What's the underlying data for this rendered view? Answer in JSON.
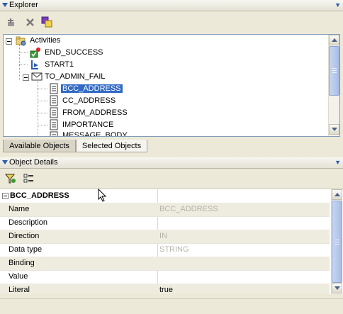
{
  "explorer": {
    "title": "Explorer",
    "toolbar": [
      "add-node-icon",
      "delete-icon",
      "copy-icon"
    ],
    "tree": {
      "root": "Activities",
      "items": [
        "END_SUCCESS",
        "START1",
        "TO_ADMIN_FAIL"
      ],
      "children": [
        "BCC_ADDRESS",
        "CC_ADDRESS",
        "FROM_ADDRESS",
        "IMPORTANCE",
        "MESSAGE_BODY"
      ]
    },
    "tabs": [
      "Available Objects",
      "Selected Objects"
    ]
  },
  "details": {
    "title": "Object Details",
    "toolbar": [
      "filter-icon",
      "categorize-icon"
    ],
    "header": "BCC_ADDRESS",
    "rows": [
      {
        "name": "Name",
        "value": "BCC_ADDRESS"
      },
      {
        "name": "Description",
        "value": ""
      },
      {
        "name": "Direction",
        "value": "IN"
      },
      {
        "name": "Data type",
        "value": "STRING"
      },
      {
        "name": "Binding",
        "value": ""
      },
      {
        "name": "Value",
        "value": ""
      },
      {
        "name": "Literal",
        "value": "true"
      }
    ]
  },
  "colors": {
    "selection": "#316ac5",
    "panel": "#ece9d8",
    "accent": "#2a5cb0"
  }
}
